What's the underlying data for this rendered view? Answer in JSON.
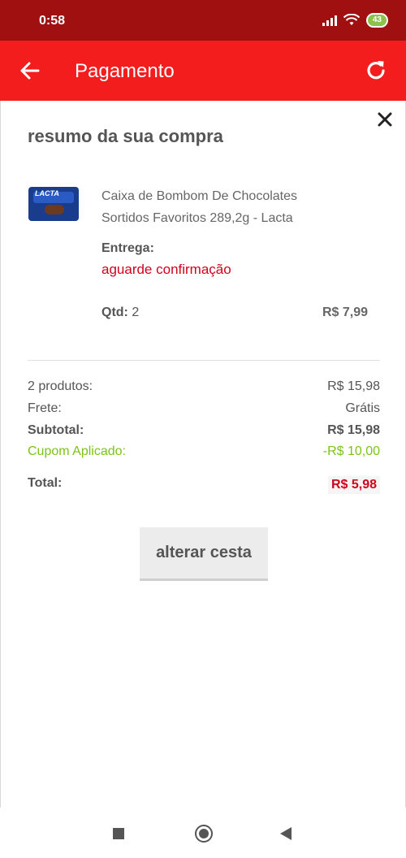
{
  "status_bar": {
    "time": "0:58",
    "battery": "43"
  },
  "app_bar": {
    "title": "Pagamento",
    "back_icon": "arrow-left-icon",
    "refresh_icon": "refresh-icon"
  },
  "summary": {
    "heading": "resumo da sua compra",
    "close_icon": "close-icon",
    "product": {
      "name": "Caixa de Bombom De Chocolates Sortidos Favoritos 289,2g - Lacta",
      "image_logo": "LACTA",
      "delivery_label": "Entrega:",
      "delivery_status": "aguarde confirmação",
      "qty_label": "Qtd:",
      "qty_value": "2",
      "price": "R$ 7,99"
    },
    "totals": {
      "products_label": "2 produtos:",
      "products_value": "R$ 15,98",
      "shipping_label": "Frete:",
      "shipping_value": "Grátis",
      "subtotal_label": "Subtotal:",
      "subtotal_value": "R$ 15,98",
      "coupon_label": "Cupom Aplicado:",
      "coupon_value": "-R$ 10,00",
      "total_label": "Total:",
      "total_value": "R$ 5,98"
    },
    "change_basket_button": "alterar cesta"
  },
  "colors": {
    "app_bar": "#f31d1d",
    "status_bar": "#a01010",
    "accent_red": "#d0021b",
    "coupon_green": "#7cc416"
  }
}
